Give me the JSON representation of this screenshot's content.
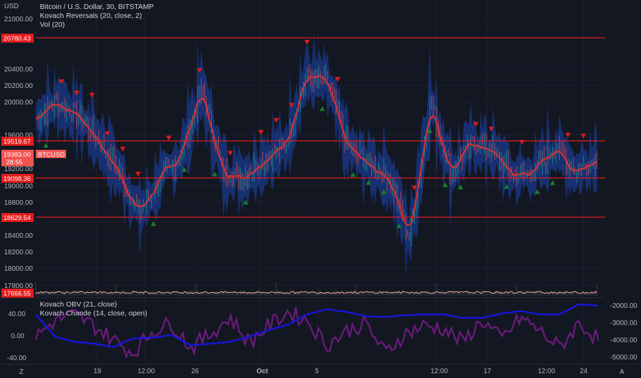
{
  "colors": {
    "background": "#131722",
    "grid": "#1e222d",
    "level_line": "#e51c1c",
    "level_box": "#e51c1c",
    "price_box": "#f05350",
    "bull_candle": "#26a69a",
    "bear_candle": "#ef5350",
    "band": "#1a3a8c",
    "signal_line": "#e03030",
    "buy_marker": "#1b7a2a",
    "sell_marker": "#d81b1b",
    "volume_line": "#ffb3a0",
    "obv_line": "#1515e0",
    "chande_line": "#6a1b7a"
  },
  "header": {
    "currency": "USD",
    "title": "Bitcoin / U.S. Dollar, 30, BITSTAMP",
    "indicator1": "Kovach Reversals (20, close, 2)",
    "indicator2": "Vol (20)"
  },
  "price_axis": {
    "ticks": [
      "21000.00",
      "20400.00",
      "20200.00",
      "20000.00",
      "19600.00",
      "19200.00",
      "19000.00",
      "18800.00",
      "18400.00",
      "18200.00",
      "18000.00",
      "17800.00"
    ]
  },
  "levels": {
    "l1": "20780.43",
    "l2": "19519.67",
    "l3": "19098.36",
    "l4": "18629.54",
    "l5": "17666.55"
  },
  "current_price": {
    "symbol": "BTCUSD",
    "price": "19383.00",
    "countdown": "28:55"
  },
  "lower_pane": {
    "legend1": "Kovach OBV (21, close)",
    "legend2": "Kovach Chande (14, close, open)",
    "left_ticks": [
      "40.00",
      "0.00",
      "-40.00"
    ],
    "right_ticks": [
      "-2000.00",
      "-3000.00",
      "-4000.00",
      "-5000.00"
    ]
  },
  "time_axis": {
    "labels": [
      "19",
      "12:00",
      "26",
      "Oct",
      "5",
      "12:00",
      "17",
      "12:00",
      "24"
    ]
  },
  "corner": {
    "left": "Z",
    "right": "A"
  },
  "chart_data": [
    {
      "type": "candlestick",
      "title": "Bitcoin / U.S. Dollar, 30, BITSTAMP",
      "ylabel": "USD",
      "ylim": [
        17666.55,
        21100
      ],
      "x": [
        "19",
        "12:00",
        "26",
        "Oct",
        "5",
        "12:00",
        "17",
        "12:00",
        "24"
      ],
      "series": [
        {
          "name": "price",
          "values": [
            19850,
            20050,
            19900,
            19600,
            19200,
            18700,
            19100,
            19400,
            20200,
            19200,
            19150,
            19350,
            19500,
            20350,
            20300,
            19500,
            19300,
            19150,
            18400,
            20050,
            19200,
            19550,
            19450,
            19150,
            19200,
            19500,
            19200,
            19383
          ]
        }
      ],
      "horizontal_levels": [
        20780.43,
        19519.67,
        19098.36,
        18629.54,
        17666.55
      ],
      "current_price": 19383.0
    },
    {
      "type": "line",
      "ylim": [
        -45,
        55
      ],
      "series": [
        {
          "name": "Kovach OBV (21, close)",
          "values": [
            -2500,
            -3800,
            -4100,
            -4200,
            -4400,
            -3900,
            -3850,
            -3700,
            -4300,
            -4200,
            -4100,
            -3800,
            -3400,
            -3100,
            -2500,
            -2200,
            -2350,
            -2600,
            -2650,
            -2550,
            -2500,
            -2500,
            -2700,
            -2700,
            -2450,
            -2300,
            -2500,
            -2500,
            -1900,
            -2000
          ]
        },
        {
          "name": "Kovach Chande (14, close, open)",
          "values": [
            0,
            30,
            40,
            20,
            -5,
            -30,
            10,
            25,
            -20,
            5,
            35,
            -10,
            20,
            45,
            30,
            -15,
            10,
            25,
            -30,
            5,
            20,
            15,
            -10,
            30,
            -5,
            35,
            10,
            -20,
            25,
            -5
          ]
        }
      ]
    }
  ]
}
